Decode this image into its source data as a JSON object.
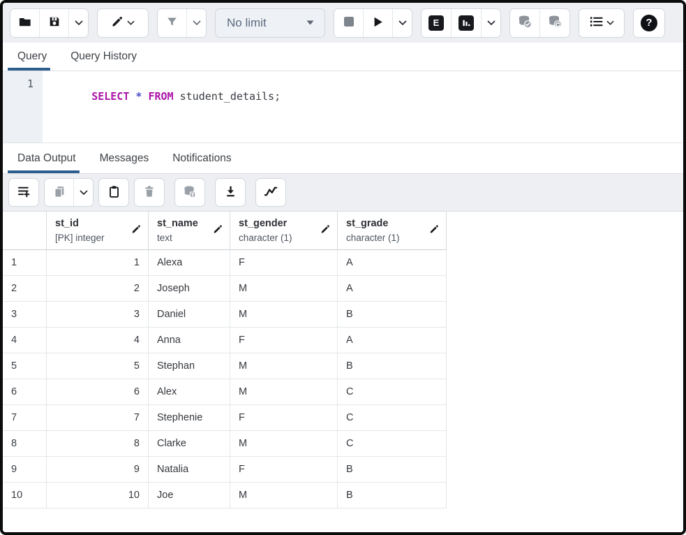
{
  "colors": {
    "accent_tab_underline": "#2e5e8d",
    "toolbar_bg": "#edeff3",
    "icon_black": "#17191c",
    "icon_disabled_gray": "#9aa0a7",
    "sql_keyword": "#ab14a8",
    "sql_operator": "#4646c8",
    "frame_border": "#0b0b0b"
  },
  "toolbar": {
    "limit_select": {
      "value": "No limit"
    },
    "explain_label": "E",
    "help_label": "?",
    "buttons": [
      {
        "name": "open-file",
        "icon": "folder-icon",
        "enabled": true
      },
      {
        "name": "save",
        "icon": "floppy-icon",
        "enabled": true,
        "has_dropdown": true
      },
      {
        "name": "edit",
        "icon": "pencil-icon",
        "enabled": true,
        "has_dropdown": true
      },
      {
        "name": "filter",
        "icon": "funnel-icon",
        "enabled": false,
        "has_dropdown": true
      },
      {
        "name": "limit-select",
        "icon": "caret-down-icon",
        "enabled": true
      },
      {
        "name": "cancel-query",
        "icon": "stop-icon",
        "enabled": false
      },
      {
        "name": "execute",
        "icon": "play-icon",
        "enabled": true,
        "has_dropdown": true
      },
      {
        "name": "explain",
        "icon": "explain-e-icon",
        "enabled": true
      },
      {
        "name": "explain-analyze",
        "icon": "bar-chart-icon",
        "enabled": true,
        "has_dropdown": true
      },
      {
        "name": "commit",
        "icon": "database-check-icon",
        "enabled": false
      },
      {
        "name": "rollback",
        "icon": "database-undo-icon",
        "enabled": false
      },
      {
        "name": "macros",
        "icon": "numbered-list-icon",
        "enabled": true,
        "has_dropdown": true
      },
      {
        "name": "help",
        "icon": "question-circle-icon",
        "enabled": true
      }
    ]
  },
  "editor_tabs": {
    "items": [
      {
        "label": "Query",
        "active": true
      },
      {
        "label": "Query History",
        "active": false
      }
    ]
  },
  "editor": {
    "line_number": "1",
    "tokens": [
      {
        "text": "SELECT",
        "type": "keyword"
      },
      {
        "text": " ",
        "type": "plain"
      },
      {
        "text": "*",
        "type": "operator"
      },
      {
        "text": " ",
        "type": "plain"
      },
      {
        "text": "FROM",
        "type": "keyword"
      },
      {
        "text": " student_details;",
        "type": "plain"
      }
    ]
  },
  "output_tabs": {
    "items": [
      {
        "label": "Data Output",
        "active": true
      },
      {
        "label": "Messages",
        "active": false
      },
      {
        "label": "Notifications",
        "active": false
      }
    ]
  },
  "output_toolbar": {
    "buttons": [
      {
        "name": "add-row",
        "icon": "add-row-icon",
        "enabled": true
      },
      {
        "name": "copy",
        "icon": "copy-icon",
        "enabled": false,
        "has_dropdown": true
      },
      {
        "name": "paste",
        "icon": "clipboard-icon",
        "enabled": true
      },
      {
        "name": "delete-row",
        "icon": "trash-icon",
        "enabled": false
      },
      {
        "name": "save-data-changes",
        "icon": "database-save-icon",
        "enabled": false
      },
      {
        "name": "save-results-to-file",
        "icon": "download-icon",
        "enabled": true
      },
      {
        "name": "graph-visualiser",
        "icon": "line-graph-icon",
        "enabled": true
      }
    ]
  },
  "grid": {
    "columns": [
      {
        "name": "st_id",
        "type": "[PK] integer",
        "align": "right"
      },
      {
        "name": "st_name",
        "type": "text",
        "align": "left"
      },
      {
        "name": "st_gender",
        "type": "character (1)",
        "align": "left"
      },
      {
        "name": "st_grade",
        "type": "character (1)",
        "align": "left"
      }
    ],
    "rows": [
      {
        "n": "1",
        "cells": [
          "1",
          "Alexa",
          "F",
          "A"
        ]
      },
      {
        "n": "2",
        "cells": [
          "2",
          "Joseph",
          "M",
          "A"
        ]
      },
      {
        "n": "3",
        "cells": [
          "3",
          "Daniel",
          "M",
          "B"
        ]
      },
      {
        "n": "4",
        "cells": [
          "4",
          "Anna",
          "F",
          "A"
        ]
      },
      {
        "n": "5",
        "cells": [
          "5",
          "Stephan",
          "M",
          "B"
        ]
      },
      {
        "n": "6",
        "cells": [
          "6",
          "Alex",
          "M",
          "C"
        ]
      },
      {
        "n": "7",
        "cells": [
          "7",
          "Stephenie",
          "F",
          "C"
        ]
      },
      {
        "n": "8",
        "cells": [
          "8",
          "Clarke",
          "M",
          "C"
        ]
      },
      {
        "n": "9",
        "cells": [
          "9",
          "Natalia",
          "F",
          "B"
        ]
      },
      {
        "n": "10",
        "cells": [
          "10",
          "Joe",
          "M",
          "B"
        ]
      }
    ]
  }
}
